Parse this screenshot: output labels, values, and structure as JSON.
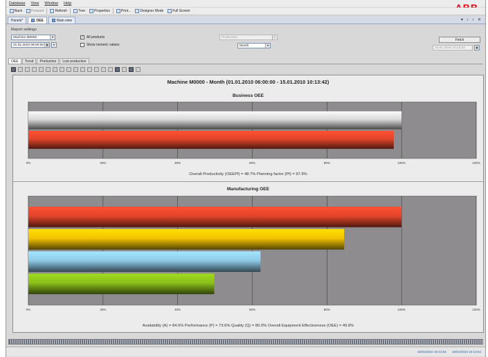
{
  "menu": [
    "Database",
    "View",
    "Window",
    "Help"
  ],
  "brand": {
    "logo_text": "ABB",
    "color": "#e3000f"
  },
  "toolbar": [
    {
      "label": "Back",
      "icon": "back-arrow-icon",
      "disabled": false
    },
    {
      "label": "Forward",
      "icon": "forward-arrow-icon",
      "disabled": true
    },
    {
      "label": "Refresh",
      "icon": "refresh-icon",
      "disabled": false
    },
    {
      "label": "Tree",
      "icon": "tree-icon",
      "disabled": false
    },
    {
      "label": "Properties",
      "icon": "properties-icon",
      "disabled": false
    },
    {
      "label": "Print...",
      "icon": "print-icon",
      "disabled": false
    },
    {
      "label": "Designer Mode",
      "icon": "designer-icon",
      "disabled": false
    },
    {
      "label": "Full Screen",
      "icon": "fullscreen-icon",
      "disabled": false
    }
  ],
  "doc_tabs": [
    {
      "label": "Panels*",
      "active": false
    },
    {
      "label": "OEE",
      "active": true
    },
    {
      "label": "Main view",
      "active": false
    }
  ],
  "window_controls": "▾ ‹ › ✕",
  "settings": {
    "label": "Report settings",
    "machine": "Machine M0000",
    "date_from": "01.01.2010 06:00:00",
    "all_products_label": "All products",
    "all_products_checked": true,
    "show_numeric_label": "Show numeric values",
    "show_numeric_checked": false,
    "product_placeholder": "Production",
    "period": "Month",
    "fetch_label": "Fetch",
    "date_to": "15.01.2010 10:13:42"
  },
  "view_tabs": [
    {
      "label": "OEE",
      "active": true
    },
    {
      "label": "Trend",
      "active": false
    },
    {
      "label": "Production",
      "active": false
    },
    {
      "label": "Lost production",
      "active": false
    }
  ],
  "report": {
    "title": "Machine M0000 - Month (01.01.2010 06:00:00 - 15.01.2010 10:13:42)"
  },
  "chart_data": [
    {
      "type": "bar",
      "orientation": "horizontal",
      "title": "Business OEE",
      "xlim": [
        0,
        120
      ],
      "ticks": [
        0,
        20,
        40,
        60,
        80,
        100,
        120
      ],
      "tick_labels": [
        "0%",
        "20%",
        "40%",
        "60%",
        "80%",
        "100%",
        "120%"
      ],
      "grid": true,
      "plot_bg": "#8e8c8e",
      "values": [
        100,
        97.9
      ],
      "colors": [
        "#d9d9d9",
        "#e2452b"
      ],
      "footer": "Overall Productivity (OEEPf) = 48.7%  Planning factor (Pf) = 97.9%"
    },
    {
      "type": "bar",
      "orientation": "horizontal",
      "title": "Manufacturing OEE",
      "xlim": [
        0,
        120
      ],
      "ticks": [
        0,
        20,
        40,
        60,
        80,
        100,
        120
      ],
      "tick_labels": [
        "0%",
        "20%",
        "40%",
        "60%",
        "80%",
        "100%",
        "120%"
      ],
      "grid": true,
      "plot_bg": "#8e8c8e",
      "values": [
        100,
        84.6,
        62.2,
        49.8
      ],
      "colors": [
        "#e2452b",
        "#f3c300",
        "#8ec9e6",
        "#8bbf1a"
      ],
      "footer": "Availability (A) = 84.6%  Performance (P) = 73.6%  Quality (Q) = 80.0%  Overall Equipment Effectiveness (OEE) = 49.8%"
    }
  ],
  "status": {
    "time_1": "15/01/2010 10:13:54",
    "time_2": "15/01/2010 10:13:54"
  }
}
